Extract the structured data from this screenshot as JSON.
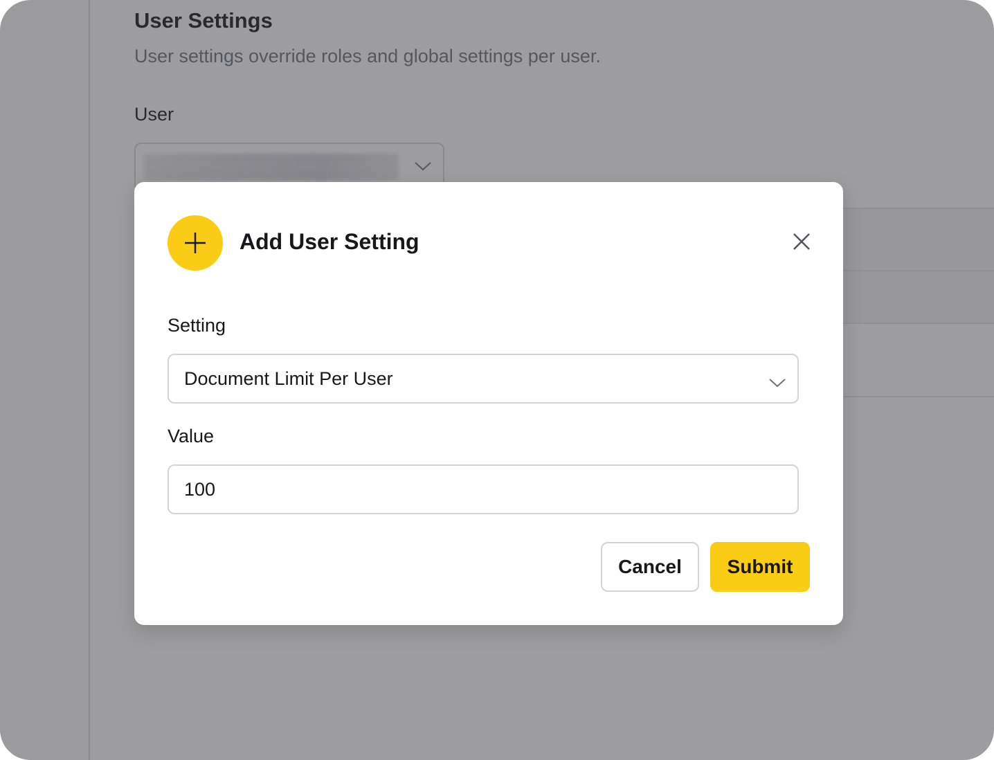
{
  "page": {
    "title": "User Settings",
    "subtitle": "User settings override roles and global settings per user.",
    "user_label": "User",
    "user_select_value_redacted": true
  },
  "modal": {
    "icon": "plus-icon",
    "title": "Add User Setting",
    "close_icon": "close-icon",
    "setting": {
      "label": "Setting",
      "selected": "Document Limit Per User",
      "chevron_icon": "chevron-down-icon"
    },
    "value": {
      "label": "Value",
      "current": "100"
    },
    "cancel_label": "Cancel",
    "submit_label": "Submit"
  },
  "colors": {
    "accent": "#facc15",
    "overlay": "rgba(60,60,66,0.5)",
    "text": "#18181b",
    "muted": "#71717a",
    "border": "#d4d4d8"
  }
}
